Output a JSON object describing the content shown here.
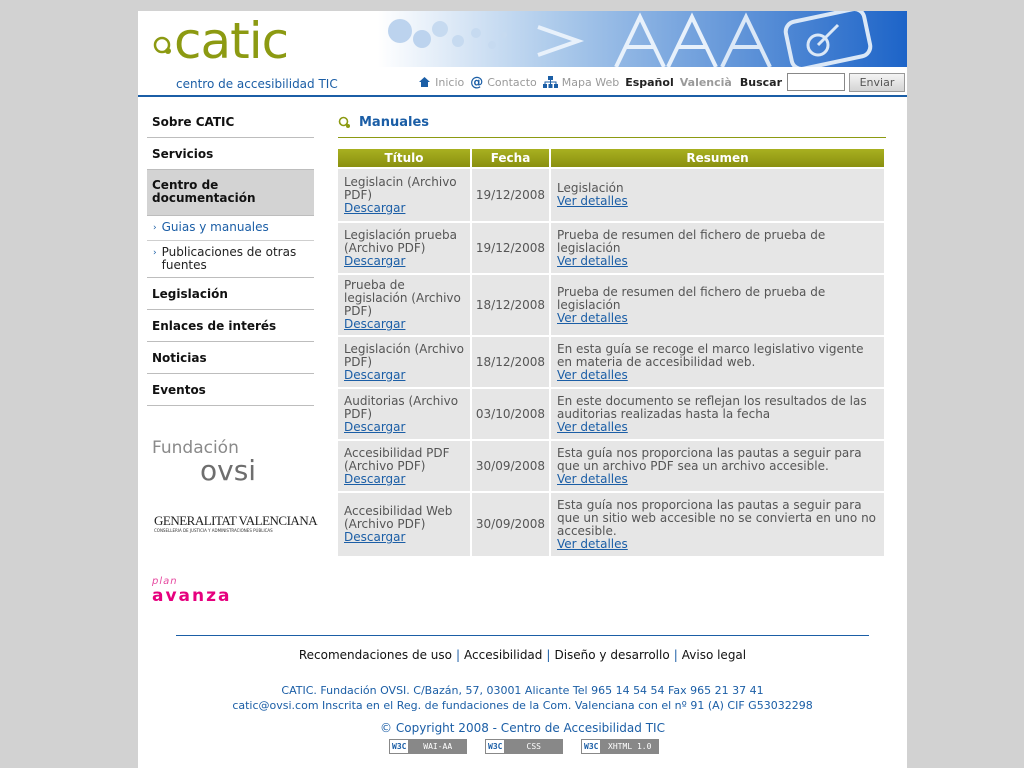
{
  "header": {
    "logo_text": "catic",
    "logo_sub": "centro de accesibilidad TIC",
    "nav": [
      {
        "label": "Inicio",
        "icon": "home-icon"
      },
      {
        "label": "Contacto",
        "icon": "at-icon"
      },
      {
        "label": "Mapa Web",
        "icon": "sitemap-icon"
      }
    ],
    "lang_es": "Español",
    "lang_va": "Valencià",
    "search_label": "Buscar",
    "search_value": "",
    "search_button": "Enviar"
  },
  "sidebar": {
    "items": [
      {
        "label": "Sobre CATIC"
      },
      {
        "label": "Servicios"
      },
      {
        "label": "Centro de documentación"
      },
      {
        "label": "Legislación"
      },
      {
        "label": "Enlaces de interés"
      },
      {
        "label": "Noticias"
      },
      {
        "label": "Eventos"
      }
    ],
    "subitems": [
      {
        "label": "Guias y manuales"
      },
      {
        "label": "Publicaciones de otras fuentes"
      }
    ],
    "logos": {
      "fundacion_top": "Fundación",
      "fundacion_bottom": "ovsi",
      "gv_main": "GENERALITAT VALENCIANA",
      "gv_sub": "CONSELLERIA DE JUSTICIA Y ADMINISTRACIONES PÚBLICAS",
      "plan_top": "plan",
      "plan_bottom": "avanza"
    }
  },
  "main": {
    "title": "Manuales",
    "columns": [
      "Título",
      "Fecha",
      "Resumen"
    ],
    "download_label": "Descargar",
    "details_label": "Ver detalles",
    "rows": [
      {
        "titulo": "Legislacin (Archivo PDF)",
        "fecha": "19/12/2008",
        "resumen": "Legislación"
      },
      {
        "titulo": "Legislación prueba (Archivo PDF)",
        "fecha": "19/12/2008",
        "resumen": "Prueba de resumen del fichero de prueba de legislación"
      },
      {
        "titulo": "Prueba de legislación (Archivo PDF)",
        "fecha": "18/12/2008",
        "resumen": "Prueba de resumen del fichero de prueba de legislación"
      },
      {
        "titulo": "Legislación (Archivo PDF)",
        "fecha": "18/12/2008",
        "resumen": "En esta guía se recoge el marco legislativo vigente en materia de accesibilidad web."
      },
      {
        "titulo": "Auditorias (Archivo PDF)",
        "fecha": "03/10/2008",
        "resumen": "En este documento se reflejan los resultados de las auditorias realizadas hasta la fecha"
      },
      {
        "titulo": "Accesibilidad PDF (Archivo PDF)",
        "fecha": "30/09/2008",
        "resumen": "Esta guía nos proporciona las pautas a seguir para que un archivo PDF sea un archivo accesible."
      },
      {
        "titulo": "Accesibilidad Web (Archivo PDF)",
        "fecha": "30/09/2008",
        "resumen": "Esta guía nos proporciona las pautas a seguir para que un sitio web accesible no se convierta en uno no accesible."
      }
    ]
  },
  "footer": {
    "links": [
      "Recomendaciones de uso",
      "Accesibilidad",
      "Diseño y desarrollo",
      "Aviso legal"
    ],
    "separator": "|",
    "address_1": "CATIC. Fundación OVSI. C/Bazán, 57, 03001 Alicante Tel 965 14 54 54 Fax 965 21 37 41",
    "address_2": "catic@ovsi.com Inscrita en el Reg. de fundaciones de la Com. Valenciana con el nº 91 (A) CIF G53032298",
    "copyright": "© Copyright 2008 - Centro de Accesibilidad TIC",
    "badges": [
      {
        "left": "W3C",
        "right": "WAI-AA"
      },
      {
        "left": "W3C",
        "right": "CSS"
      },
      {
        "left": "W3C",
        "right": "XHTML 1.0"
      }
    ]
  },
  "colors": {
    "brand_olive": "#8c9a12",
    "brand_blue": "#1b5ea6",
    "page_bg": "#d2d2d2"
  }
}
